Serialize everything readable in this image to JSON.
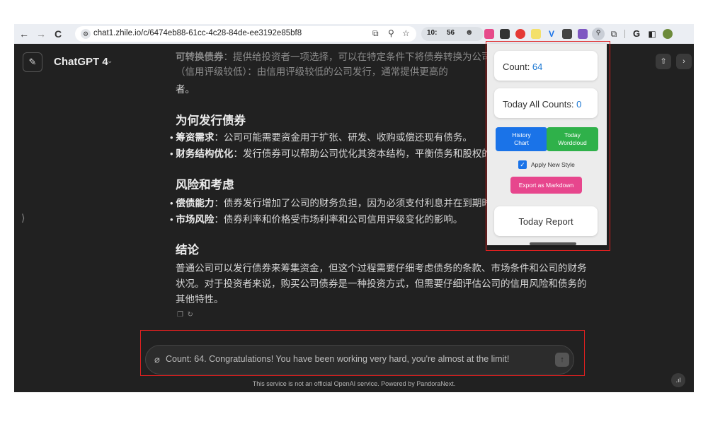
{
  "browser": {
    "back": "←",
    "forward": "→",
    "reload": "C",
    "url": "chat1.zhile.io/c/6474eb88-61cc-4c28-84de-ee3192e85bf8",
    "ext_counter_a": "10:",
    "ext_counter_b": "56"
  },
  "app": {
    "model_label": "ChatGPT 4"
  },
  "content": {
    "faded_line1_term": "可转换债券",
    "faded_line1_text": "：提供给投资者一项选择，可以在特定条件下将债券转换为公司的股",
    "faded_line2_text": "（信用评级较低）：由信用评级较低的公司发行，通常提供更高的",
    "cont_line": "者。",
    "h_why": "为何发行债券",
    "b1_term": "筹资需求",
    "b1_text": "：公司可能需要资金用于扩张、研发、收购或偿还现有债务。",
    "b2_term": "财务结构优化",
    "b2_text": "：发行债券可以帮助公司优化其资本结构，平衡债务和股权的比例",
    "h_risk": "风险和考虑",
    "b3_term": "偿债能力",
    "b3_text": "：债券发行增加了公司的财务负担，因为必须支付利息并在到期时偿还",
    "b4_term": "市场风险",
    "b4_text": "：债券利率和价格受市场利率和公司信用评级变化的影响。",
    "h_concl": "结论",
    "concl_l1": "普通公司可以发行债券来筹集资金，但这个过程需要仔细考虑债务的条款、市场条件和公司的财务",
    "concl_l2": "状况。对于投资者来说，购买公司债券是一种投资方式，但需要仔细评估公司的信用风险和债务的",
    "concl_l3": "其他特性。"
  },
  "composer": {
    "text": "Count: 64. Congratulations! You have been working very hard, you're almost at the limit!"
  },
  "footer": {
    "disclaimer": "This service is not an official OpenAI service. Powered by PandoraNext."
  },
  "popup": {
    "count_label": "Count: ",
    "count_value": "64",
    "today_label": "Today All Counts: ",
    "today_value": "0",
    "history_btn_l1": "History",
    "history_btn_l2": "Chart",
    "wordcloud_btn_l1": "Today",
    "wordcloud_btn_l2": "Wordcloud",
    "apply_style_label": "Apply New Style",
    "apply_style_checked": true,
    "export_btn": "Export as Markdown",
    "report_btn": "Today Report"
  },
  "colors": {
    "chat_bg": "#212121",
    "history_btn": "#1a73e8",
    "wordcloud_btn": "#2fb14a",
    "export_btn": "#e7468d",
    "highlight_box": "#e02020",
    "count_value": "#1976d2"
  }
}
